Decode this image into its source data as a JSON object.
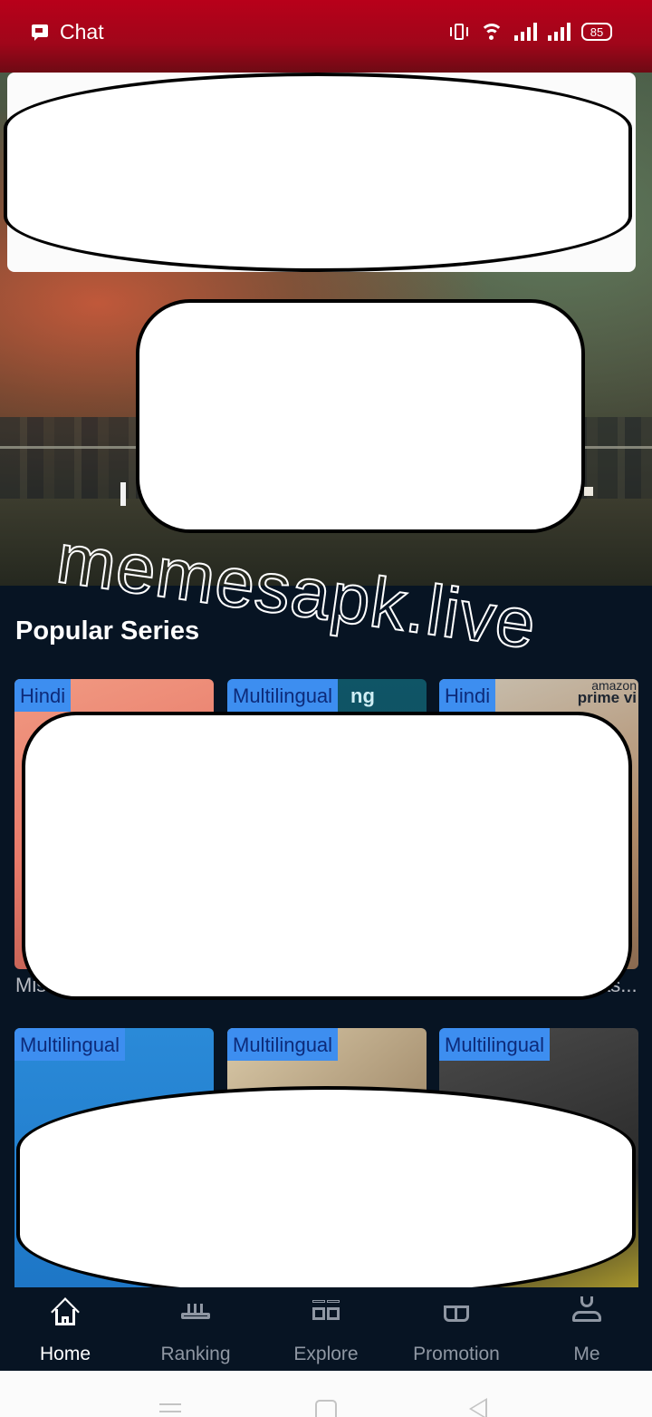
{
  "status_bar": {
    "notification_label": "Chat",
    "notification_icon": "chat-bubble-icon",
    "icons": [
      "vibrate-icon",
      "wifi-icon",
      "signal-icon",
      "signal-icon"
    ],
    "battery_level": "85"
  },
  "hero": {
    "carousel_total_slides": 6,
    "carousel_active_index": 0,
    "accent_color": "#e0253e"
  },
  "watermark": "memesapk.live",
  "popular_series": {
    "title": "Popular Series",
    "rows": [
      [
        {
          "badge": "Hindi",
          "title_visible": "Mis…"
        },
        {
          "badge": "Multilingual",
          "poster_text": "ng",
          "title_visible": ""
        },
        {
          "badge": "Hindi",
          "poster_text": "amazon prime video",
          "title_visible": "…as..."
        }
      ],
      [
        {
          "badge": "Multilingual",
          "title_visible": ""
        },
        {
          "badge": "Multilingual",
          "title_visible": ""
        },
        {
          "badge": "Multilingual",
          "title_visible": ""
        }
      ]
    ],
    "badge_color": "#3d8ef0"
  },
  "bottom_nav": {
    "items": [
      {
        "label": "Home",
        "icon": "home-icon",
        "active": true
      },
      {
        "label": "Ranking",
        "icon": "ranking-icon",
        "active": false
      },
      {
        "label": "Explore",
        "icon": "explore-icon",
        "active": false
      },
      {
        "label": "Promotion",
        "icon": "promotion-icon",
        "active": false
      },
      {
        "label": "Me",
        "icon": "profile-icon",
        "active": false
      }
    ]
  },
  "system_nav": [
    "menu-icon",
    "home-icon",
    "back-icon"
  ]
}
